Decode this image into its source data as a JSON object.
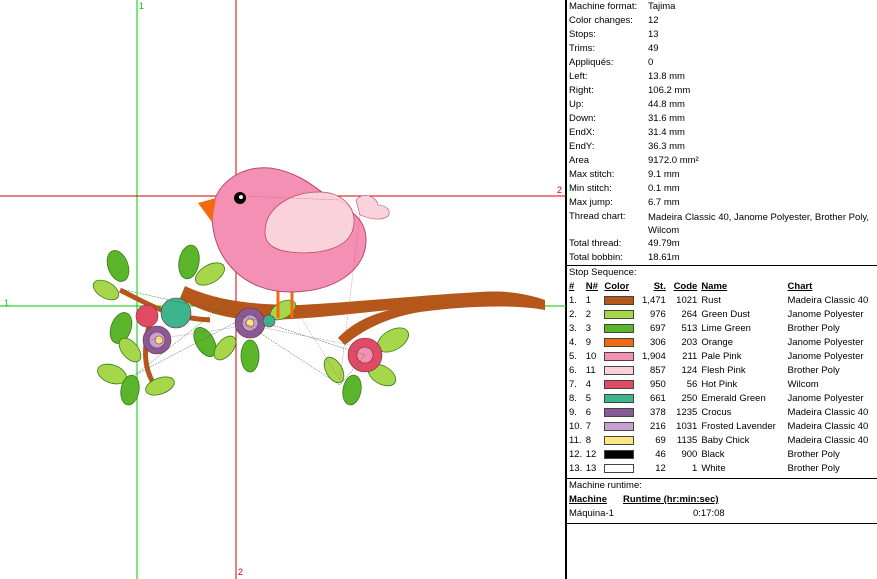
{
  "info": [
    {
      "key": "Machine format:",
      "value": "Tajima"
    },
    {
      "key": "Color changes:",
      "value": "12"
    },
    {
      "key": "Stops:",
      "value": "13"
    },
    {
      "key": "Trims:",
      "value": "49"
    },
    {
      "key": "Appliqués:",
      "value": "0"
    },
    {
      "key": "Left:",
      "value": "13.8 mm"
    },
    {
      "key": "Right:",
      "value": "106.2 mm"
    },
    {
      "key": "Up:",
      "value": "44.8 mm"
    },
    {
      "key": "Down:",
      "value": "31.6 mm"
    },
    {
      "key": "EndX:",
      "value": "31.4 mm"
    },
    {
      "key": "EndY:",
      "value": "36.3 mm"
    },
    {
      "key": "Area",
      "value": "9172.0 mm²"
    },
    {
      "key": "Max stitch:",
      "value": "9.1 mm"
    },
    {
      "key": "Min stitch:",
      "value": "0.1 mm"
    },
    {
      "key": "Max jump:",
      "value": "6.7 mm"
    },
    {
      "key": "Thread chart:",
      "value": "Madeira Classic 40, Janome Polyester, Brother Poly, Wilcom"
    },
    {
      "key": "Total thread:",
      "value": "49.79m"
    },
    {
      "key": "Total bobbin:",
      "value": "18.61m"
    }
  ],
  "stop_sequence": {
    "title": "Stop Sequence:",
    "headers": {
      "idx": "#",
      "n": "N#",
      "color": "Color",
      "st": "St.",
      "code": "Code",
      "name": "Name",
      "chart": "Chart"
    },
    "rows": [
      {
        "idx": "1.",
        "n": "1",
        "color": "#b5561b",
        "st": "1,471",
        "code": "1021",
        "name": "Rust",
        "chart": "Madeira Classic 40"
      },
      {
        "idx": "2.",
        "n": "2",
        "color": "#a6d64a",
        "st": "976",
        "code": "264",
        "name": "Green Dust",
        "chart": "Janome Polyester"
      },
      {
        "idx": "3.",
        "n": "3",
        "color": "#5ab52a",
        "st": "697",
        "code": "513",
        "name": "Lime Green",
        "chart": "Brother Poly"
      },
      {
        "idx": "4.",
        "n": "9",
        "color": "#f26a10",
        "st": "306",
        "code": "203",
        "name": "Orange",
        "chart": "Janome Polyester"
      },
      {
        "idx": "5.",
        "n": "10",
        "color": "#f590b5",
        "st": "1,904",
        "code": "211",
        "name": "Pale Pink",
        "chart": "Janome Polyester"
      },
      {
        "idx": "6.",
        "n": "11",
        "color": "#fad2dc",
        "st": "857",
        "code": "124",
        "name": "Flesh Pink",
        "chart": "Brother Poly"
      },
      {
        "idx": "7.",
        "n": "4",
        "color": "#e04a64",
        "st": "950",
        "code": "56",
        "name": "Hot Pink",
        "chart": "Wilcom"
      },
      {
        "idx": "8.",
        "n": "5",
        "color": "#3cb48c",
        "st": "661",
        "code": "250",
        "name": "Emerald Green",
        "chart": "Janome Polyester"
      },
      {
        "idx": "9.",
        "n": "6",
        "color": "#8a5a96",
        "st": "378",
        "code": "1235",
        "name": "Crocus",
        "chart": "Madeira Classic 40"
      },
      {
        "idx": "10.",
        "n": "7",
        "color": "#c8a0d2",
        "st": "216",
        "code": "1031",
        "name": "Frosted Lavender",
        "chart": "Madeira Classic 40"
      },
      {
        "idx": "11.",
        "n": "8",
        "color": "#fae682",
        "st": "69",
        "code": "1135",
        "name": "Baby Chick",
        "chart": "Madeira Classic 40"
      },
      {
        "idx": "12.",
        "n": "12",
        "color": "#000000",
        "st": "46",
        "code": "900",
        "name": "Black",
        "chart": "Brother Poly"
      },
      {
        "idx": "13.",
        "n": "13",
        "color": "#ffffff",
        "st": "12",
        "code": "1",
        "name": "White",
        "chart": "Brother Poly"
      }
    ]
  },
  "runtime": {
    "title": "Machine runtime:",
    "col_machine": "Machine",
    "col_runtime": "Runtime (hr:min:sec)",
    "machine": "Máquina-1",
    "time": "0:17:08"
  },
  "guides": {
    "v1_label": "1",
    "v2_label": "2",
    "h1_label": "1",
    "h2_label": "2",
    "green": "#00c800",
    "red": "#d20000"
  }
}
